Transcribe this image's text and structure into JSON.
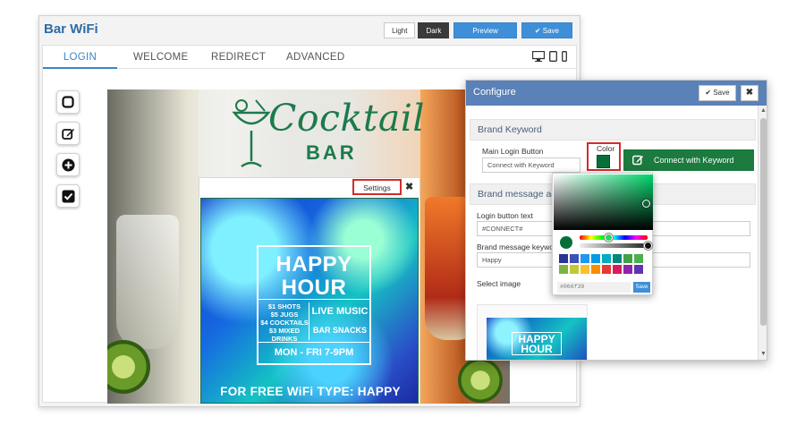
{
  "app": {
    "title": "Bar WiFi",
    "theme_light": "Light",
    "theme_dark": "Dark",
    "preview_label": "Preview",
    "save_label": "✔ Save"
  },
  "tabs": [
    {
      "label": "LOGIN",
      "active": true
    },
    {
      "label": "WELCOME",
      "active": false
    },
    {
      "label": "REDIRECT",
      "active": false
    },
    {
      "label": "ADVANCED",
      "active": false
    }
  ],
  "devices": [
    "desktop-icon",
    "tablet-icon",
    "phone-icon"
  ],
  "tools": [
    "square-icon",
    "edit-icon",
    "plus-circle-icon",
    "checkbox-icon"
  ],
  "preview": {
    "logo_word": "Cocktail",
    "logo_sub": "BAR",
    "settings_label": "Settings",
    "close_label": "✖",
    "poster": {
      "title_line1": "HAPPY",
      "title_line2": "HOUR",
      "deals": [
        "$1 SHOTS",
        "$5 JUGS",
        "$4 COCKTAILS",
        "$3 MIXED",
        "DRINKS"
      ],
      "live_music": "LIVE MUSIC",
      "bar_snacks": "BAR SNACKS",
      "schedule": "MON - FRI 7-9PM",
      "wifi_text": "FOR FREE WiFi TYPE: HAPPY"
    }
  },
  "configure": {
    "title": "Configure",
    "save_label": "✔ Save",
    "close_label": "✖",
    "brand_keyword": {
      "heading": "Brand Keyword",
      "main_login_label": "Main Login Button",
      "main_login_value": "Connect with Keyword",
      "color_label": "Color",
      "color_value": "#066f39",
      "connect_button": "Connect with Keyword"
    },
    "brand_message": {
      "heading": "Brand message ad",
      "login_text_label": "Login button text",
      "login_text_value": "#CONNECT#",
      "keyword_label": "Brand message keywo",
      "keyword_value": "Happy",
      "select_image_label": "Select image",
      "thumb_text": "HAPPY HOUR"
    }
  },
  "picker": {
    "hex_value": "#066f39",
    "save_label": "Save",
    "palette": [
      "#283593",
      "#3f51b5",
      "#2196f3",
      "#039be5",
      "#00acc1",
      "#00897b",
      "#43a047",
      "#4caf50",
      "#7cb342",
      "#c0ca33",
      "#fbc02d",
      "#fb8c00",
      "#e53935",
      "#d81b60",
      "#8e24aa",
      "#5e35b1"
    ]
  }
}
